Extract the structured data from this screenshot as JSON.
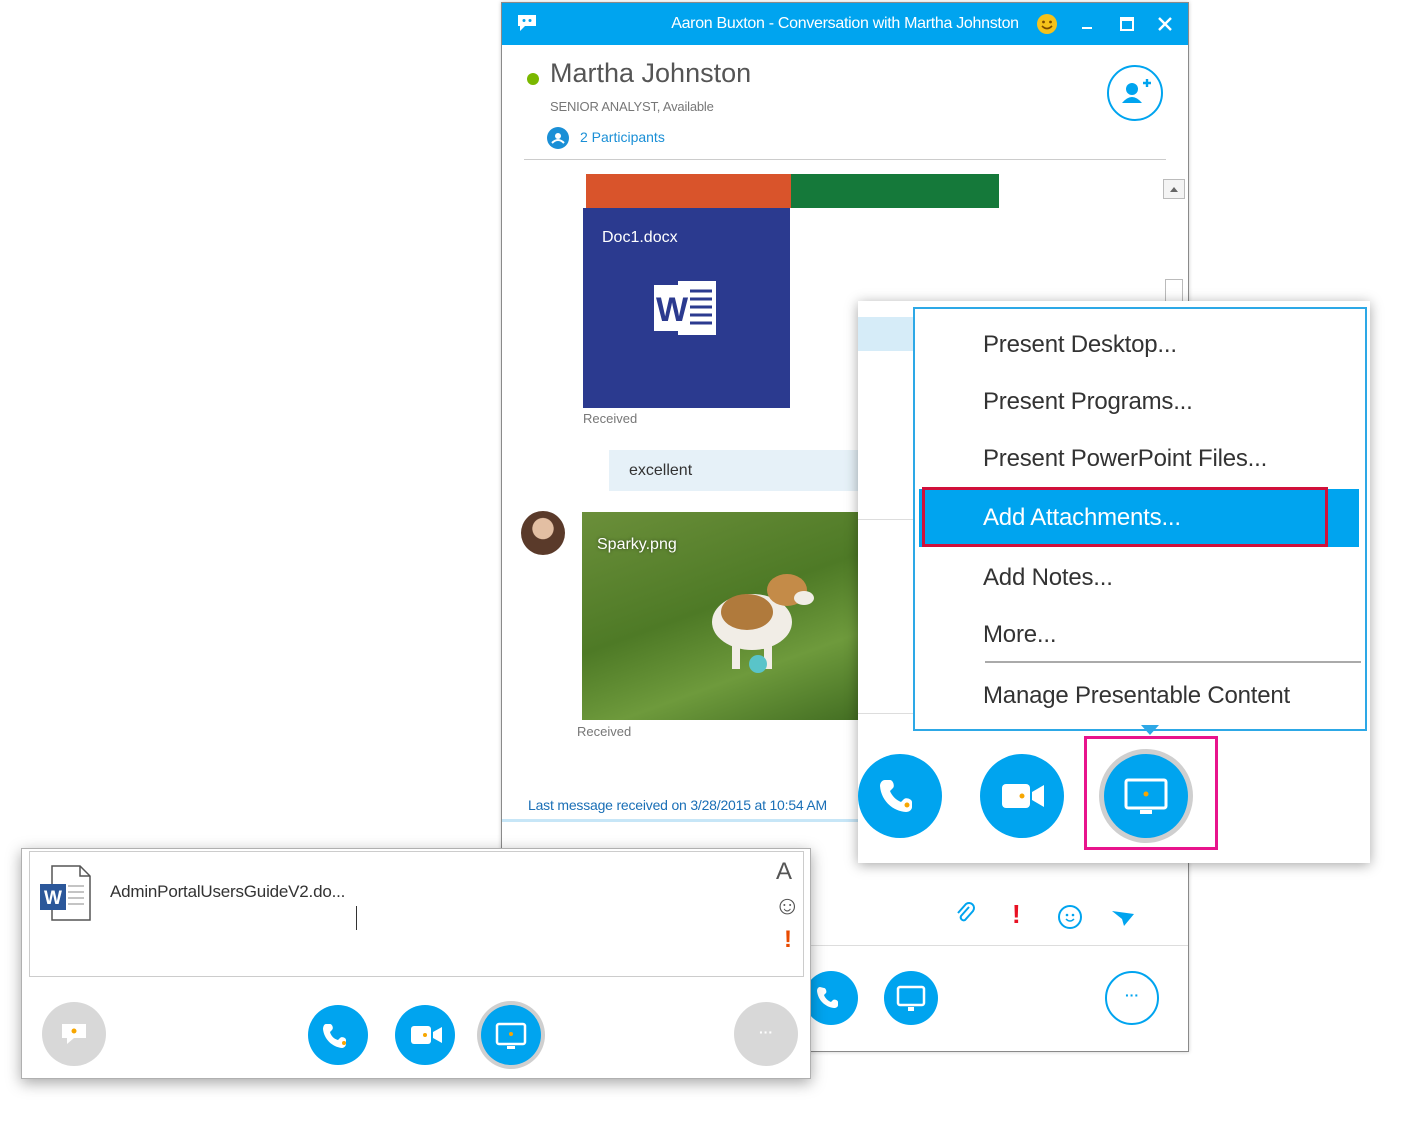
{
  "window": {
    "title": "Aaron Buxton - Conversation with Martha Johnston"
  },
  "contact": {
    "name": "Martha Johnston",
    "subtitle": "SENIOR ANALYST,  Available",
    "participants": "2 Participants",
    "status_color": "#7ab800"
  },
  "chat": {
    "doc_name": "Doc1.docx",
    "doc_received": "Received",
    "message": "excellent",
    "photo_name": "Sparky.png",
    "photo_received": "Received",
    "last_message": "Last message received on 3/28/2015 at 10:54 AM"
  },
  "menu": {
    "items": [
      {
        "label": "Present Desktop..."
      },
      {
        "label": "Present Programs..."
      },
      {
        "label": "Present PowerPoint Files..."
      },
      {
        "label": "Add Attachments..."
      },
      {
        "label": "Add Notes..."
      },
      {
        "label": "More..."
      },
      {
        "label": "Manage Presentable Content"
      }
    ],
    "highlighted_index": 3
  },
  "composer": {
    "attachment_name": "AdminPortalUsersGuideV2.do..."
  },
  "icons": {
    "font": "A",
    "emoji": "☺",
    "important": "!",
    "more": "···"
  },
  "colors": {
    "accent": "#00a4ef",
    "highlight_border": "#d0103a",
    "present_border": "#e8148c",
    "word_blue": "#2b3a8f",
    "doc_bar_orange": "#d9542b",
    "doc_bar_green": "#15793a"
  }
}
